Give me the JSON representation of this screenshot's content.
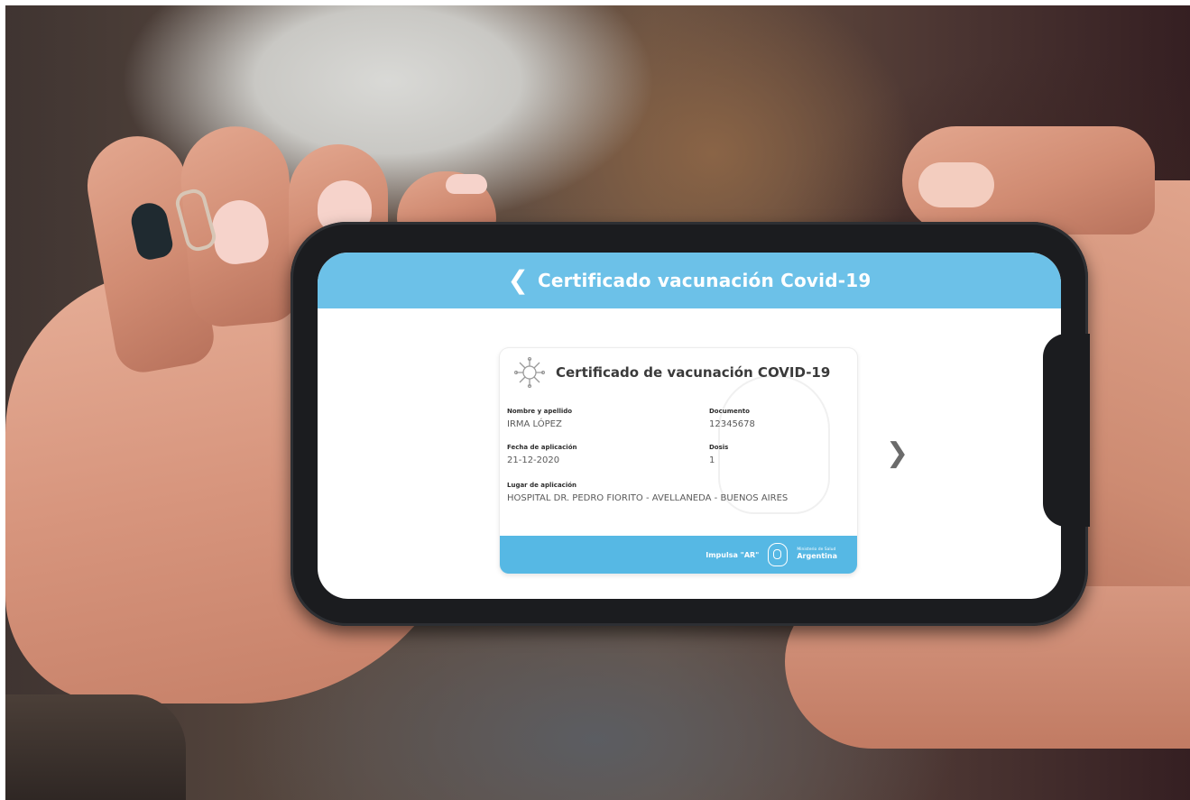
{
  "app": {
    "header_title": "Certificado vacunación Covid-19",
    "back_icon": "chevron-left-icon",
    "next_icon": "chevron-right-icon",
    "accent_color": "#6cc1e8"
  },
  "certificate": {
    "title": "Certificado de vacunación COVID-19",
    "icon": "virus-icon",
    "fields": [
      {
        "label": "Nombre y apellido",
        "value": "IRMA LÓPEZ"
      },
      {
        "label": "Documento",
        "value": "12345678"
      },
      {
        "label": "Fecha de aplicación",
        "value": "21-12-2020"
      },
      {
        "label": "Dosis",
        "value": "1"
      },
      {
        "label": "Lugar de aplicación",
        "value": "HOSPITAL DR. PEDRO FIORITO - AVELLANEDA - BUENOS AIRES"
      }
    ],
    "footer": {
      "impulsa": "Impulsa \"AR\"",
      "ministry_small": "Ministerio de Salud",
      "ministry_big": "Argentina",
      "seal_icon": "coat-of-arms-icon",
      "footer_color": "#56b8e4"
    }
  }
}
